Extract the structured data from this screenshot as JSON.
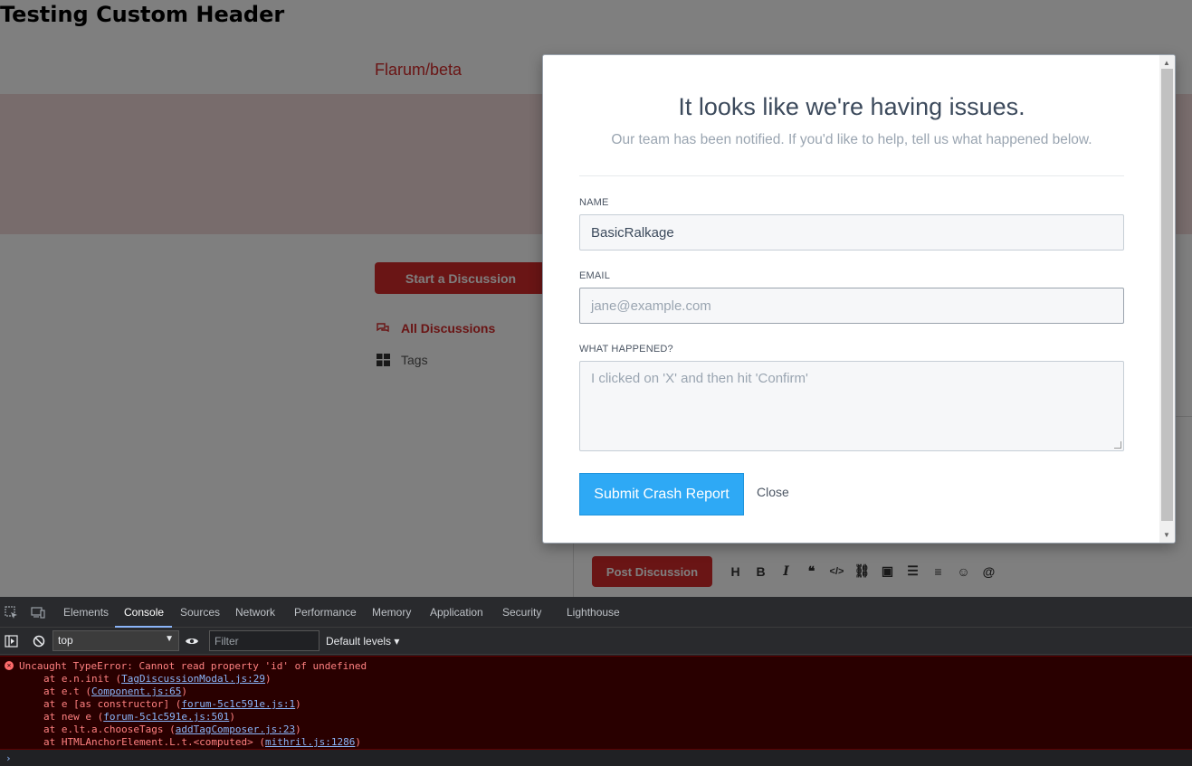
{
  "page": {
    "custom_header": "Testing Custom Header",
    "brand": "Flarum/beta",
    "start_discussion": "Start a Discussion",
    "nav": [
      {
        "label": "All Discussions",
        "icon": "comments-icon"
      },
      {
        "label": "Tags",
        "icon": "grid-icon"
      }
    ],
    "post_discussion": "Post Discussion",
    "toolbar_icons": [
      "H",
      "B",
      "I",
      "“”",
      "</>",
      "⁠⛓",
      "▣",
      "≡",
      "☰",
      "☺",
      "@"
    ]
  },
  "modal": {
    "title": "It looks like we're having issues.",
    "subtitle": "Our team has been notified. If you'd like to help, tell us what happened below.",
    "name_label": "NAME",
    "name_value": "BasicRalkage",
    "email_label": "EMAIL",
    "email_placeholder": "jane@example.com",
    "what_label": "WHAT HAPPENED?",
    "what_placeholder": "I clicked on 'X' and then hit 'Confirm'",
    "submit": "Submit Crash Report",
    "close": "Close"
  },
  "devtools": {
    "tabs": [
      "Elements",
      "Console",
      "Sources",
      "Network",
      "Performance",
      "Memory",
      "Application",
      "Security",
      "Lighthouse"
    ],
    "active_tab": "Console",
    "context": "top",
    "filter_placeholder": "Filter",
    "levels": "Default levels ▾",
    "error": {
      "message": "Uncaught TypeError: Cannot read property 'id' of undefined",
      "stack": [
        {
          "pre": "at e.n.init (",
          "link": "TagDiscussionModal.js:29",
          "post": ")"
        },
        {
          "pre": "at e.t (",
          "link": "Component.js:65",
          "post": ")"
        },
        {
          "pre": "at e [as constructor] (",
          "link": "forum-5c1c591e.js:1",
          "post": ")"
        },
        {
          "pre": "at new e (",
          "link": "forum-5c1c591e.js:501",
          "post": ")"
        },
        {
          "pre": "at e.lt.a.chooseTags (",
          "link": "addTagComposer.js:23",
          "post": ")"
        },
        {
          "pre": "at HTMLAnchorElement.L.t.<computed> (",
          "link": "mithril.js:1286",
          "post": ")"
        }
      ]
    },
    "prompt": "›"
  }
}
